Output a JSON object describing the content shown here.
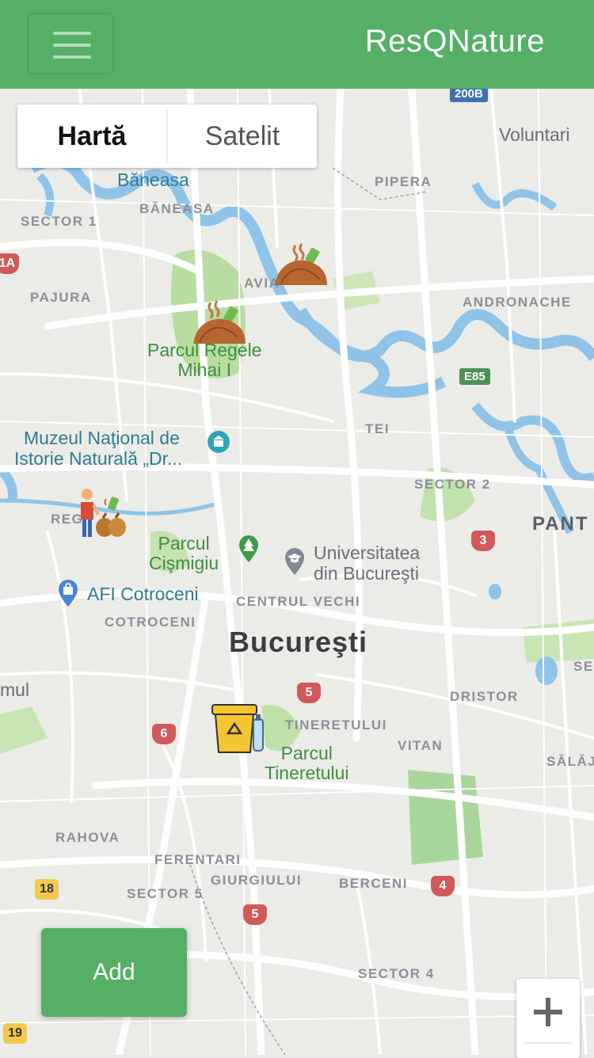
{
  "app": {
    "title": "ResQNature"
  },
  "map": {
    "type_control": {
      "map_label": "Hartă",
      "satellite_label": "Satelit",
      "selected": "Hartă"
    },
    "labels": {
      "voluntari": "Voluntari",
      "baneasa_poi": "Băneasa",
      "baneasa": "BĂNEASA",
      "pipera": "PIPERA",
      "sector1": "SECTOR 1",
      "pajura": "PAJURA",
      "aviatiei": "AVIA",
      "andronache": "ANDRONACHE",
      "parcul_regele_1": "Parcul Regele",
      "parcul_regele_2": "Mihai I",
      "tei": "TEI",
      "muzeul_1": "Muzeul Naţional de",
      "muzeul_2": "Istorie Naturală „Dr...",
      "sector2": "SECTOR 2",
      "pant": "PANT",
      "regie": "REG",
      "cismigiu_1": "Parcul",
      "cismigiu_2": "Cişmigiu",
      "univ_1": "Universitatea",
      "univ_2": "din Bucureşti",
      "afi": "AFI Cotroceni",
      "centrul_vechi": "CENTRUL VECHI",
      "cotroceni": "COTROCENI",
      "city": "Bucureşti",
      "sec3": "SEC",
      "mul": "mul",
      "dristor": "DRISTOR",
      "tineretului": "TINERETULUI",
      "parcul_tin_1": "Parcul",
      "parcul_tin_2": "Tineretului",
      "vitan": "VITAN",
      "salaj": "SĂLĂJ",
      "rahova": "RAHOVA",
      "ferentari": "FERENTARI",
      "giurgiului": "GIURGIULUI",
      "berceni": "BERCENI",
      "sector5": "SECTOR 5",
      "sector4": "SECTOR 4"
    },
    "shields": {
      "r200b": "200B",
      "e85": "E85",
      "a1": "1A",
      "r3": "3",
      "r5a": "5",
      "r6": "6",
      "r4": "4",
      "r5b": "5",
      "r18": "18",
      "r19": "19"
    },
    "markers": [
      {
        "type": "waste-pile-icon"
      },
      {
        "type": "waste-pile-icon"
      },
      {
        "type": "person-with-bags-icon"
      },
      {
        "type": "recycling-bin-icon"
      }
    ]
  },
  "actions": {
    "add_label": "Add",
    "zoom_in_symbol": "+"
  },
  "colors": {
    "brand": "#55af66",
    "water": "#8fc3e8",
    "park": "#b5dca0"
  }
}
